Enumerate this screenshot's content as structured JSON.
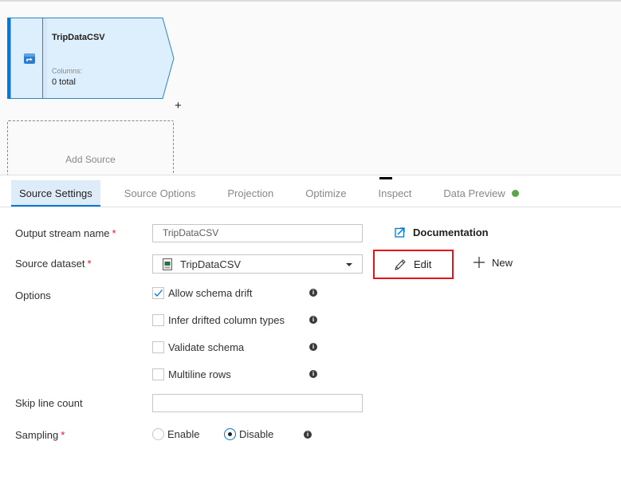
{
  "canvas": {
    "node": {
      "title": "TripDataCSV",
      "columns_label": "Columns:",
      "columns_value": "0 total",
      "add_symbol": "+",
      "icon": "source-icon"
    },
    "add_source_label": "Add Source"
  },
  "tabs": [
    {
      "label": "Source Settings",
      "active": true
    },
    {
      "label": "Source Options",
      "active": false
    },
    {
      "label": "Projection",
      "active": false
    },
    {
      "label": "Optimize",
      "active": false
    },
    {
      "label": "Inspect",
      "active": false
    },
    {
      "label": "Data Preview",
      "active": false,
      "status_dot_color": "#57a64a"
    }
  ],
  "form": {
    "output_stream": {
      "label": "Output stream name",
      "required_mark": "*",
      "value": "TripDataCSV"
    },
    "source_dataset": {
      "label": "Source dataset",
      "required_mark": "*",
      "value": "TripDataCSV",
      "icon": "csv-file-icon"
    },
    "documentation_link": "Documentation",
    "edit_button": "Edit",
    "new_button": "New",
    "options": {
      "label": "Options",
      "items": [
        {
          "label": "Allow schema drift",
          "checked": true
        },
        {
          "label": "Infer drifted column types",
          "checked": false
        },
        {
          "label": "Validate schema",
          "checked": false
        },
        {
          "label": "Multiline rows",
          "checked": false
        }
      ]
    },
    "skip_line_count": {
      "label": "Skip line count",
      "value": ""
    },
    "sampling": {
      "label": "Sampling",
      "required_mark": "*",
      "options": [
        {
          "label": "Enable",
          "selected": false
        },
        {
          "label": "Disable",
          "selected": true
        }
      ]
    },
    "info_glyph": "i"
  },
  "colors": {
    "accent": "#0078d4",
    "highlight_border": "#e3151a",
    "required": "#e81123",
    "node_fill": "#ddeefc"
  }
}
